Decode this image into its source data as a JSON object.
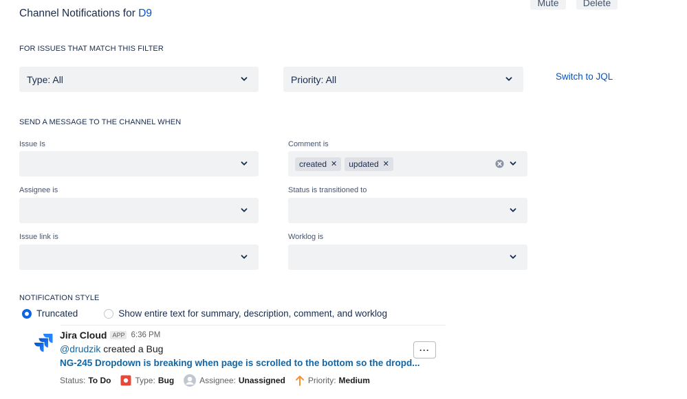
{
  "header": {
    "title_prefix": "Channel Notifications for",
    "project": "D9",
    "mute_label": "Mute",
    "delete_label": "Delete"
  },
  "filter": {
    "section_label": "FOR ISSUES THAT MATCH THIS FILTER",
    "type_value": "Type: All",
    "priority_value": "Priority: All",
    "switch_jql": "Switch to JQL"
  },
  "send": {
    "section_label": "SEND A MESSAGE TO THE CHANNEL WHEN",
    "issue_is_label": "Issue Is",
    "comment_is_label": "Comment is",
    "comment_chips": [
      "created",
      "updated"
    ],
    "assignee_label": "Assignee is",
    "status_label": "Status is transitioned to",
    "issue_link_label": "Issue link is",
    "worklog_label": "Worklog is"
  },
  "notification_style": {
    "section_label": "NOTIFICATION STYLE",
    "options": [
      "Truncated",
      "Show entire text for summary, description, comment, and worklog"
    ],
    "selected": "Truncated"
  },
  "preview": {
    "app_name": "Jira Cloud",
    "badge": "APP",
    "time": "6:36 PM",
    "mention": "@drudzik",
    "action": "created a Bug",
    "issue_link": "NG-245 Dropdown is breaking when page is scrolled to the bottom so the dropd...",
    "more": "···",
    "status_label": "Status:",
    "status_value": "To Do",
    "type_label": "Type:",
    "type_value": "Bug",
    "assignee_label": "Assignee:",
    "assignee_value": "Unassigned",
    "priority_label": "Priority:",
    "priority_value": "Medium"
  },
  "colors": {
    "link": "#0052cc",
    "slack_link": "#1264a3",
    "field_bg": "#f1f2f4",
    "bug_red": "#e5493a",
    "priority_orange": "#f79232"
  }
}
